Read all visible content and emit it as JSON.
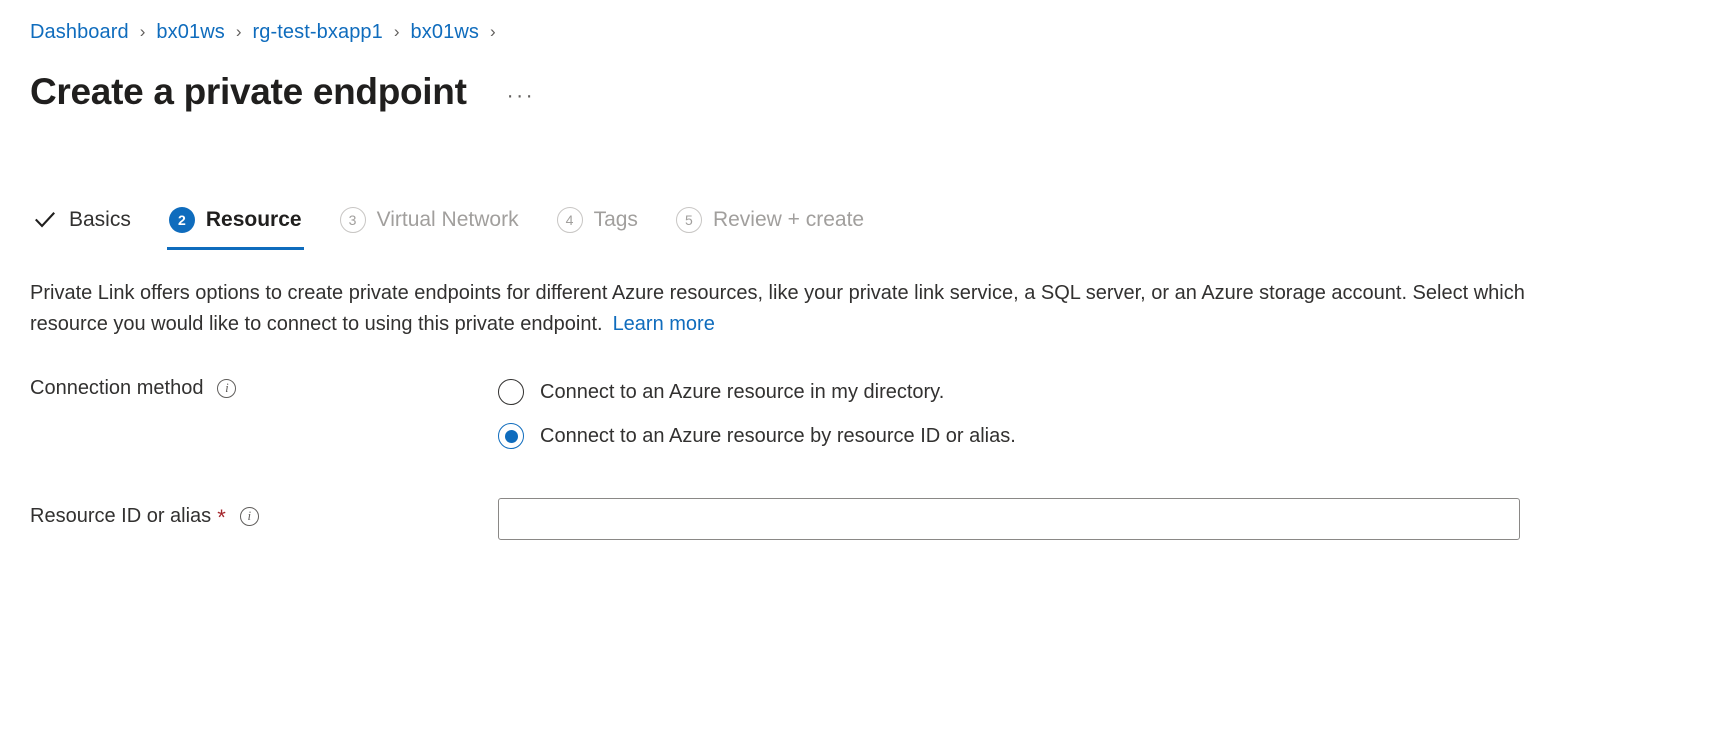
{
  "breadcrumb": {
    "separator": "›",
    "items": [
      {
        "label": "Dashboard"
      },
      {
        "label": "bx01ws"
      },
      {
        "label": "rg-test-bxapp1"
      },
      {
        "label": "bx01ws"
      }
    ]
  },
  "header": {
    "title": "Create a private endpoint",
    "more_label": "···"
  },
  "wizard": {
    "tabs": [
      {
        "label": "Basics",
        "marker": "✓",
        "state": "done"
      },
      {
        "label": "Resource",
        "marker": "2",
        "state": "active"
      },
      {
        "label": "Virtual Network",
        "marker": "3",
        "state": "upcoming"
      },
      {
        "label": "Tags",
        "marker": "4",
        "state": "upcoming"
      },
      {
        "label": "Review + create",
        "marker": "5",
        "state": "upcoming"
      }
    ]
  },
  "description": {
    "text": "Private Link offers options to create private endpoints for different Azure resources, like your private link service, a SQL server, or an Azure storage account. Select which resource you would like to connect to using this private endpoint.",
    "link_label": "Learn more"
  },
  "form": {
    "connection_method": {
      "label": "Connection method",
      "info_glyph": "i",
      "options": [
        {
          "label": "Connect to an Azure resource in my directory.",
          "selected": false
        },
        {
          "label": "Connect to an Azure resource by resource ID or alias.",
          "selected": true
        }
      ]
    },
    "resource_id": {
      "label": "Resource ID or alias",
      "required_marker": "*",
      "info_glyph": "i",
      "value": "",
      "placeholder": ""
    }
  },
  "colors": {
    "accent": "#0f6cbd",
    "link": "#0f6cbd",
    "required": "#a4262c",
    "text": "#323130",
    "muted": "#a19f9d",
    "border": "#8a8886"
  }
}
